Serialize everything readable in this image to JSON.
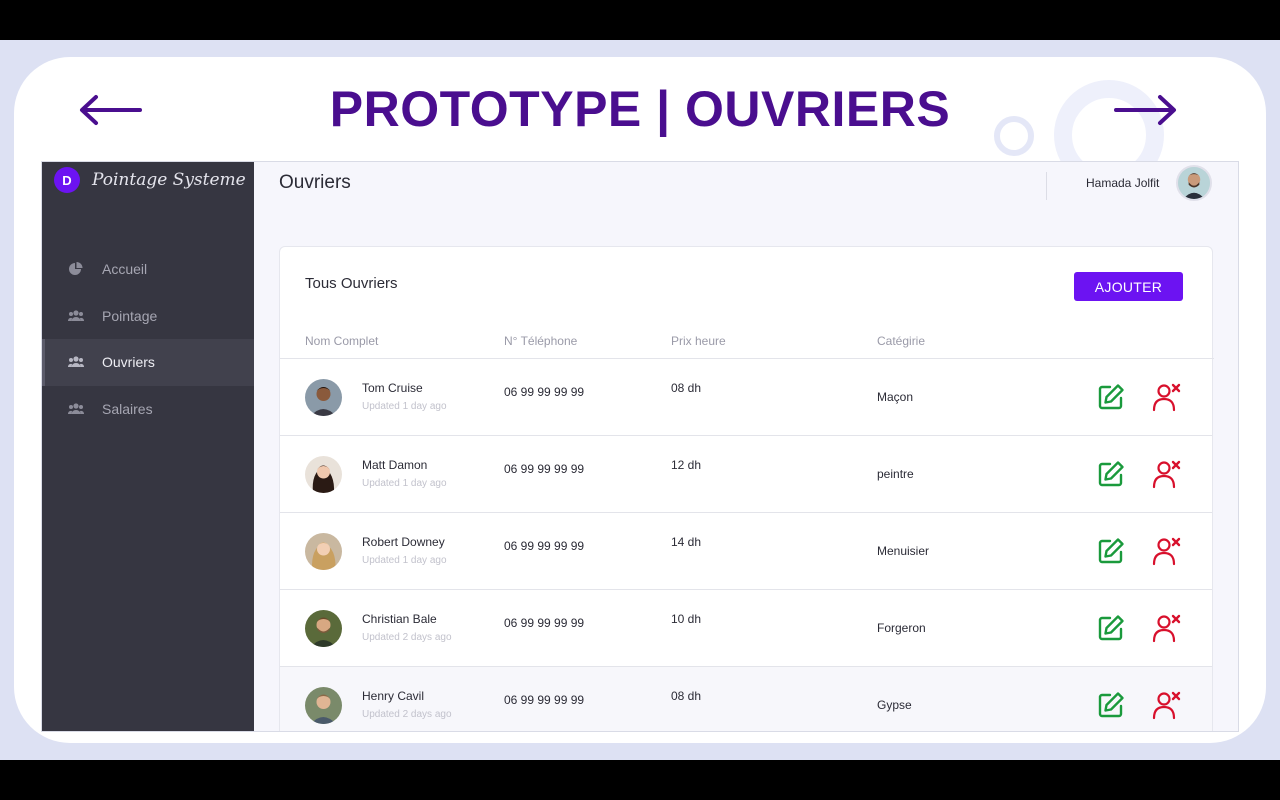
{
  "slide": {
    "title": "PROTOTYPE | OUVRIERS",
    "accent_color": "#4a0e8f",
    "nav": {
      "prev_icon": "arrow-left-icon",
      "next_icon": "arrow-right-icon"
    }
  },
  "brand": {
    "logo_letter": "D",
    "name": "Pointage Systeme",
    "color": "#6c13f2"
  },
  "sidebar": {
    "items": [
      {
        "label": "Accueil",
        "icon": "pie-chart-icon",
        "active": false
      },
      {
        "label": "Pointage",
        "icon": "users-icon",
        "active": false
      },
      {
        "label": "Ouvriers",
        "icon": "users-icon",
        "active": true
      },
      {
        "label": "Salaires",
        "icon": "users-icon",
        "active": false
      }
    ]
  },
  "header": {
    "page_title": "Ouvriers",
    "user_name": "Hamada Jolfit"
  },
  "table": {
    "title": "Tous Ouvriers",
    "add_button": "AJOUTER",
    "columns": [
      "Nom Complet",
      "N° Téléphone",
      "Prix heure",
      "Catégirie"
    ],
    "rows": [
      {
        "name": "Tom Cruise",
        "updated": "Updated 1 day ago",
        "phone": "06 99 99 99 99",
        "price": "08  dh",
        "category": "Maçon"
      },
      {
        "name": "Matt Damon",
        "updated": "Updated 1 day ago",
        "phone": "06 99 99 99 99",
        "price": "12 dh",
        "category": "peintre"
      },
      {
        "name": "Robert Downey",
        "updated": "Updated 1 day ago",
        "phone": "06 99 99 99 99",
        "price": "14 dh",
        "category": "Menuisier"
      },
      {
        "name": "Christian Bale",
        "updated": "Updated 2 days ago",
        "phone": "06 99 99 99 99",
        "price": "10 dh",
        "category": "Forgeron"
      },
      {
        "name": "Henry Cavil",
        "updated": "Updated 2 days ago",
        "phone": "06 99 99 99 99",
        "price": "08  dh",
        "category": "Gypse"
      }
    ],
    "edit_icon": "edit-icon",
    "delete_icon": "remove-user-icon",
    "edit_color": "#1a9a3c",
    "delete_color": "#d8102c"
  }
}
